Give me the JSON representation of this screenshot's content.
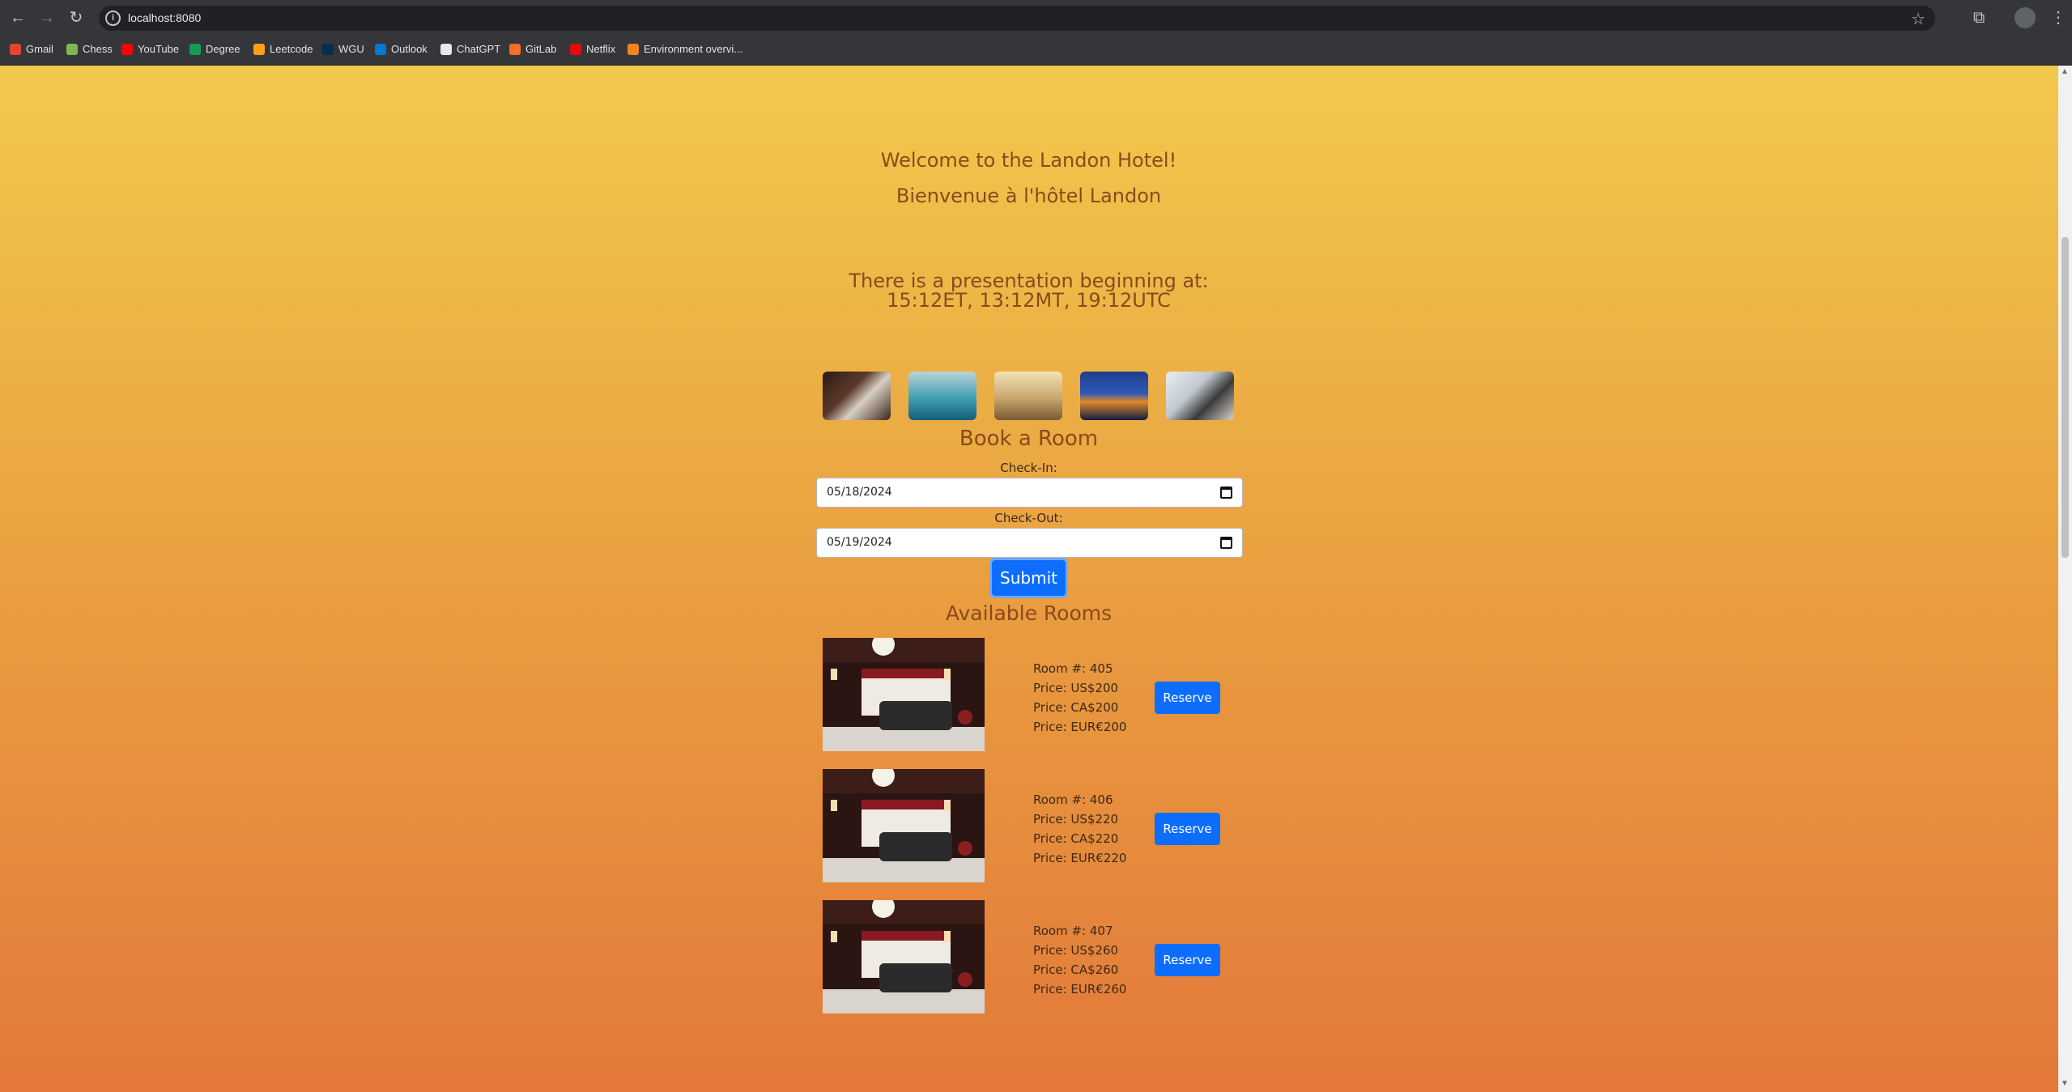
{
  "browser": {
    "url": "localhost:8080",
    "bookmarks": [
      {
        "label": "Gmail",
        "color": "#ea4335"
      },
      {
        "label": "Chess",
        "color": "#81b64c"
      },
      {
        "label": "YouTube",
        "color": "#ff0000"
      },
      {
        "label": "Degree",
        "color": "#0f9d58"
      },
      {
        "label": "Leetcode",
        "color": "#ffa116"
      },
      {
        "label": "WGU",
        "color": "#002f51"
      },
      {
        "label": "Outlook",
        "color": "#0078d4"
      },
      {
        "label": "ChatGPT",
        "color": "#e8e8e8"
      },
      {
        "label": "GitLab",
        "color": "#fc6d26"
      },
      {
        "label": "Netflix",
        "color": "#e50914"
      },
      {
        "label": "Environment overvi...",
        "color": "#f5821f"
      }
    ]
  },
  "page": {
    "welcome_en": "Welcome to the Landon Hotel!",
    "welcome_fr": "Bienvenue à l'hôtel Landon",
    "presentation": "There is a presentation beginning at: 15:12ET, 13:12MT, 19:12UTC",
    "book_title": "Book a Room",
    "checkin_label": "Check-In:",
    "checkin_value": "05/18/2024",
    "checkout_label": "Check-Out:",
    "checkout_value": "05/19/2024",
    "submit_label": "Submit",
    "available_title": "Available Rooms",
    "reserve_label": "Reserve",
    "rooms": [
      {
        "number": "Room #: 405",
        "usd": "Price: US$200",
        "cad": "Price: CA$200",
        "eur": "Price: EUR€200"
      },
      {
        "number": "Room #: 406",
        "usd": "Price: US$220",
        "cad": "Price: CA$220",
        "eur": "Price: EUR€220"
      },
      {
        "number": "Room #: 407",
        "usd": "Price: US$260",
        "cad": "Price: CA$260",
        "eur": "Price: EUR€260"
      }
    ]
  },
  "colors": {
    "gradient_top": "#f1c94c",
    "gradient_bottom": "#e3783a",
    "heading_text": "#8a4a1c",
    "button_blue": "#0d6efd"
  }
}
